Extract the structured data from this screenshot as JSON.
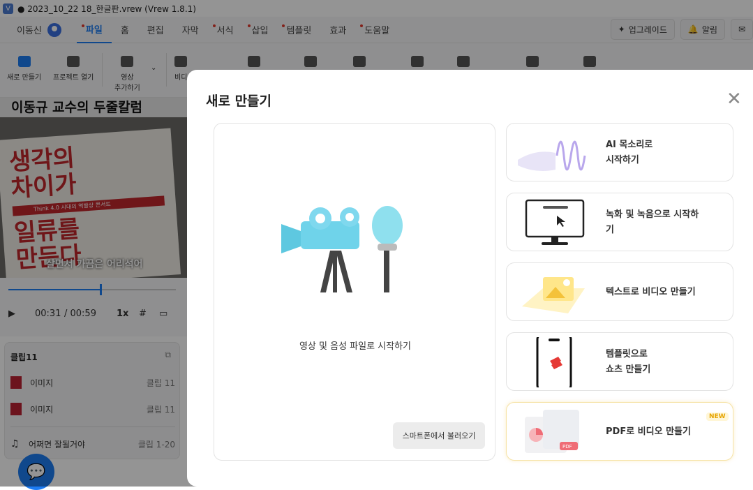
{
  "window": {
    "title": "● 2023_10_22 18_한글판.vrew (Vrew 1.8.1)"
  },
  "menubar": {
    "user": "이동신",
    "items": [
      {
        "label": "파일",
        "dot": true,
        "active": true
      },
      {
        "label": "홈",
        "dot": false,
        "active": false
      },
      {
        "label": "편집",
        "dot": false,
        "active": false
      },
      {
        "label": "자막",
        "dot": false,
        "active": false
      },
      {
        "label": "서식",
        "dot": true,
        "active": false
      },
      {
        "label": "삽입",
        "dot": true,
        "active": false
      },
      {
        "label": "템플릿",
        "dot": true,
        "active": false
      },
      {
        "label": "효과",
        "dot": false,
        "active": false
      },
      {
        "label": "도움말",
        "dot": true,
        "active": false
      }
    ],
    "upgrade": "업그레이드",
    "alarm": "알림"
  },
  "toolbar": {
    "new": "새로 만들기",
    "open": "프로젝트 열기",
    "add_video": "영상\n추가하기",
    "video_partial": "비디"
  },
  "preview": {
    "title": "이동규 교수의 두줄칼럼",
    "book_line1": "생각의",
    "book_line2": "차이가",
    "book_bar": "Think 4.0 시대의 역발상 콘서트",
    "book_line3": "일류를",
    "book_line4": "만든다",
    "subtitle": "살면서 가끔은 어리석어"
  },
  "player": {
    "current": "00:31",
    "total": "/ 00:59",
    "speed": "1x",
    "progress_fraction": 0.55
  },
  "clips": {
    "header": "클립11",
    "rows": [
      {
        "label": "이미지",
        "right": "클립 11"
      },
      {
        "label": "이미지",
        "right": "클립 11"
      },
      {
        "label": "어쩌면 잘될거야",
        "right": "클립 1-20"
      }
    ]
  },
  "modal": {
    "title": "새로 만들기",
    "main_card": "영상 및 음성 파일로 시작하기",
    "phone_button": "스마트폰에서 불러오기",
    "cards": [
      {
        "text": "AI 목소리로\n시작하기"
      },
      {
        "text": "녹화 및 녹음으로 시작하\n기"
      },
      {
        "text": "텍스트로 비디오 만들기"
      },
      {
        "text": "템플릿으로\n쇼츠 만들기"
      },
      {
        "text": "PDF로 비디오 만들기"
      }
    ],
    "new_badge": "NEW"
  },
  "colors": {
    "accent": "#1d7cf2",
    "dot": "#e03a2e"
  }
}
